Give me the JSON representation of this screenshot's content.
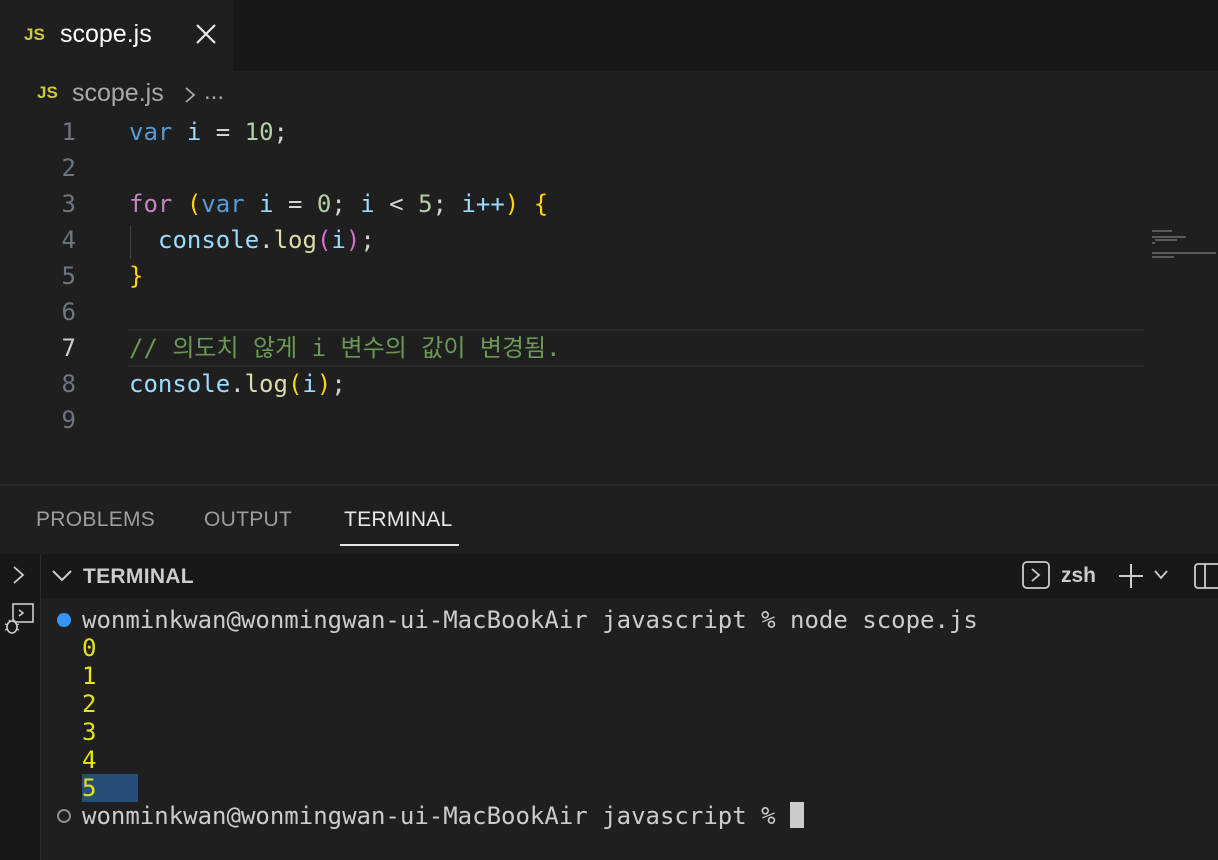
{
  "tab": {
    "lang_icon": "JS",
    "filename": "scope.js"
  },
  "breadcrumb": {
    "lang_icon": "JS",
    "file": "scope.js",
    "more": "..."
  },
  "editor": {
    "line_numbers": [
      "1",
      "2",
      "3",
      "4",
      "5",
      "6",
      "7",
      "8",
      "9"
    ],
    "active_line": "7",
    "lines": {
      "l1": {
        "kw": "var",
        "v": "i",
        "eq": "=",
        "num": "10",
        "semi": ";"
      },
      "l3": {
        "for": "for",
        "open": "(",
        "var": "var",
        "v1": "i",
        "eq": "=",
        "n0": "0",
        "s1": ";",
        "v2": "i",
        "lt": "<",
        "n5": "5",
        "s2": ";",
        "v3": "i++",
        "close": ")",
        "brace": "{"
      },
      "l4": {
        "obj": "console",
        "dot": ".",
        "fn": "log",
        "open": "(",
        "arg": "i",
        "close": ")",
        "semi": ";"
      },
      "l5": {
        "brace": "}"
      },
      "l7": {
        "comment": "// 의도치 않게 i 변수의 값이 변경됨."
      },
      "l8": {
        "obj": "console",
        "dot": ".",
        "fn": "log",
        "open": "(",
        "arg": "i",
        "close": ")",
        "semi": ";"
      }
    }
  },
  "panel": {
    "tabs": [
      "PROBLEMS",
      "OUTPUT",
      "TERMINAL"
    ],
    "active_tab": "TERMINAL",
    "header_title": "TERMINAL",
    "shell": "zsh"
  },
  "terminal": {
    "prompt": "wonminkwan@wonmingwan-ui-MacBookAir javascript % ",
    "command": "node scope.js",
    "outputs": [
      "0",
      "1",
      "2",
      "3",
      "4",
      "5"
    ],
    "final_prompt": "wonminkwan@wonmingwan-ui-MacBookAir javascript % "
  },
  "colors": {
    "accent_dot": "#3794ff",
    "output_yellow": "#e5e510",
    "selection": "#264f78"
  }
}
